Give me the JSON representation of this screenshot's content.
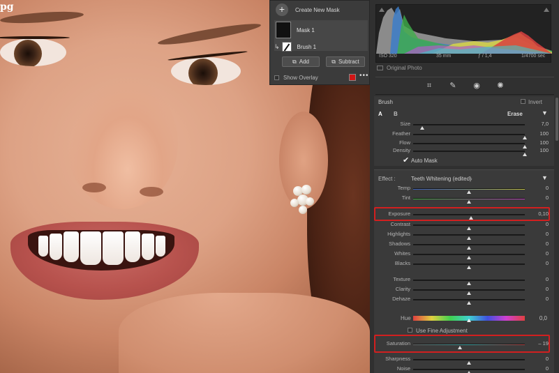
{
  "photo": {
    "file_label": "pg"
  },
  "mask_panel": {
    "create_new_mask": "Create New Mask",
    "mask_name": "Mask 1",
    "brush_name": "Brush 1",
    "add_label": "Add",
    "subtract_label": "Subtract",
    "show_overlay_label": "Show Overlay",
    "overlay_color": "#d11616"
  },
  "histogram": {
    "iso": "ISO 320",
    "focal": "35 mm",
    "aperture": "ƒ / 1,4",
    "shutter": "1/4700 sec",
    "original_photo_label": "Original Photo"
  },
  "brush": {
    "title": "Brush",
    "invert_label": "Invert",
    "tab_a": "A",
    "tab_b": "B",
    "erase_label": "Erase",
    "auto_mask_label": "Auto Mask",
    "sliders": [
      {
        "name": "size",
        "label": "Size",
        "value": "7,0",
        "pos": 0.08
      },
      {
        "name": "feather",
        "label": "Feather",
        "value": "100",
        "pos": 1.0
      },
      {
        "name": "flow",
        "label": "Flow",
        "value": "100",
        "pos": 1.0
      },
      {
        "name": "density",
        "label": "Density",
        "value": "100",
        "pos": 1.0
      }
    ]
  },
  "effect": {
    "label": "Effect :",
    "preset": "Teeth Whitening (edited)",
    "use_fine_adjustment_label": "Use Fine Adjustment",
    "hue_label": "Hue",
    "hue_value": "0,0",
    "sliders": [
      {
        "name": "temp",
        "label": "Temp",
        "value": "0",
        "pos": 0.5
      },
      {
        "name": "tint",
        "label": "Tint",
        "value": "0",
        "pos": 0.5
      },
      {
        "name": "exposure",
        "label": "Exposure",
        "value": "0,10",
        "pos": 0.52
      },
      {
        "name": "contrast",
        "label": "Contrast",
        "value": "0",
        "pos": 0.5
      },
      {
        "name": "highlights",
        "label": "Highlights",
        "value": "0",
        "pos": 0.5
      },
      {
        "name": "shadows",
        "label": "Shadows",
        "value": "0",
        "pos": 0.5
      },
      {
        "name": "whites",
        "label": "Whites",
        "value": "0",
        "pos": 0.5
      },
      {
        "name": "blacks",
        "label": "Blacks",
        "value": "0",
        "pos": 0.5
      },
      {
        "name": "texture",
        "label": "Texture",
        "value": "0",
        "pos": 0.5
      },
      {
        "name": "clarity",
        "label": "Clarity",
        "value": "0",
        "pos": 0.5
      },
      {
        "name": "dehaze",
        "label": "Dehaze",
        "value": "0",
        "pos": 0.5
      },
      {
        "name": "saturation",
        "label": "Saturation",
        "value": "– 19",
        "pos": 0.42
      },
      {
        "name": "sharpness",
        "label": "Sharpness",
        "value": "0",
        "pos": 0.5
      },
      {
        "name": "noise",
        "label": "Noise",
        "value": "0",
        "pos": 0.5
      }
    ]
  }
}
